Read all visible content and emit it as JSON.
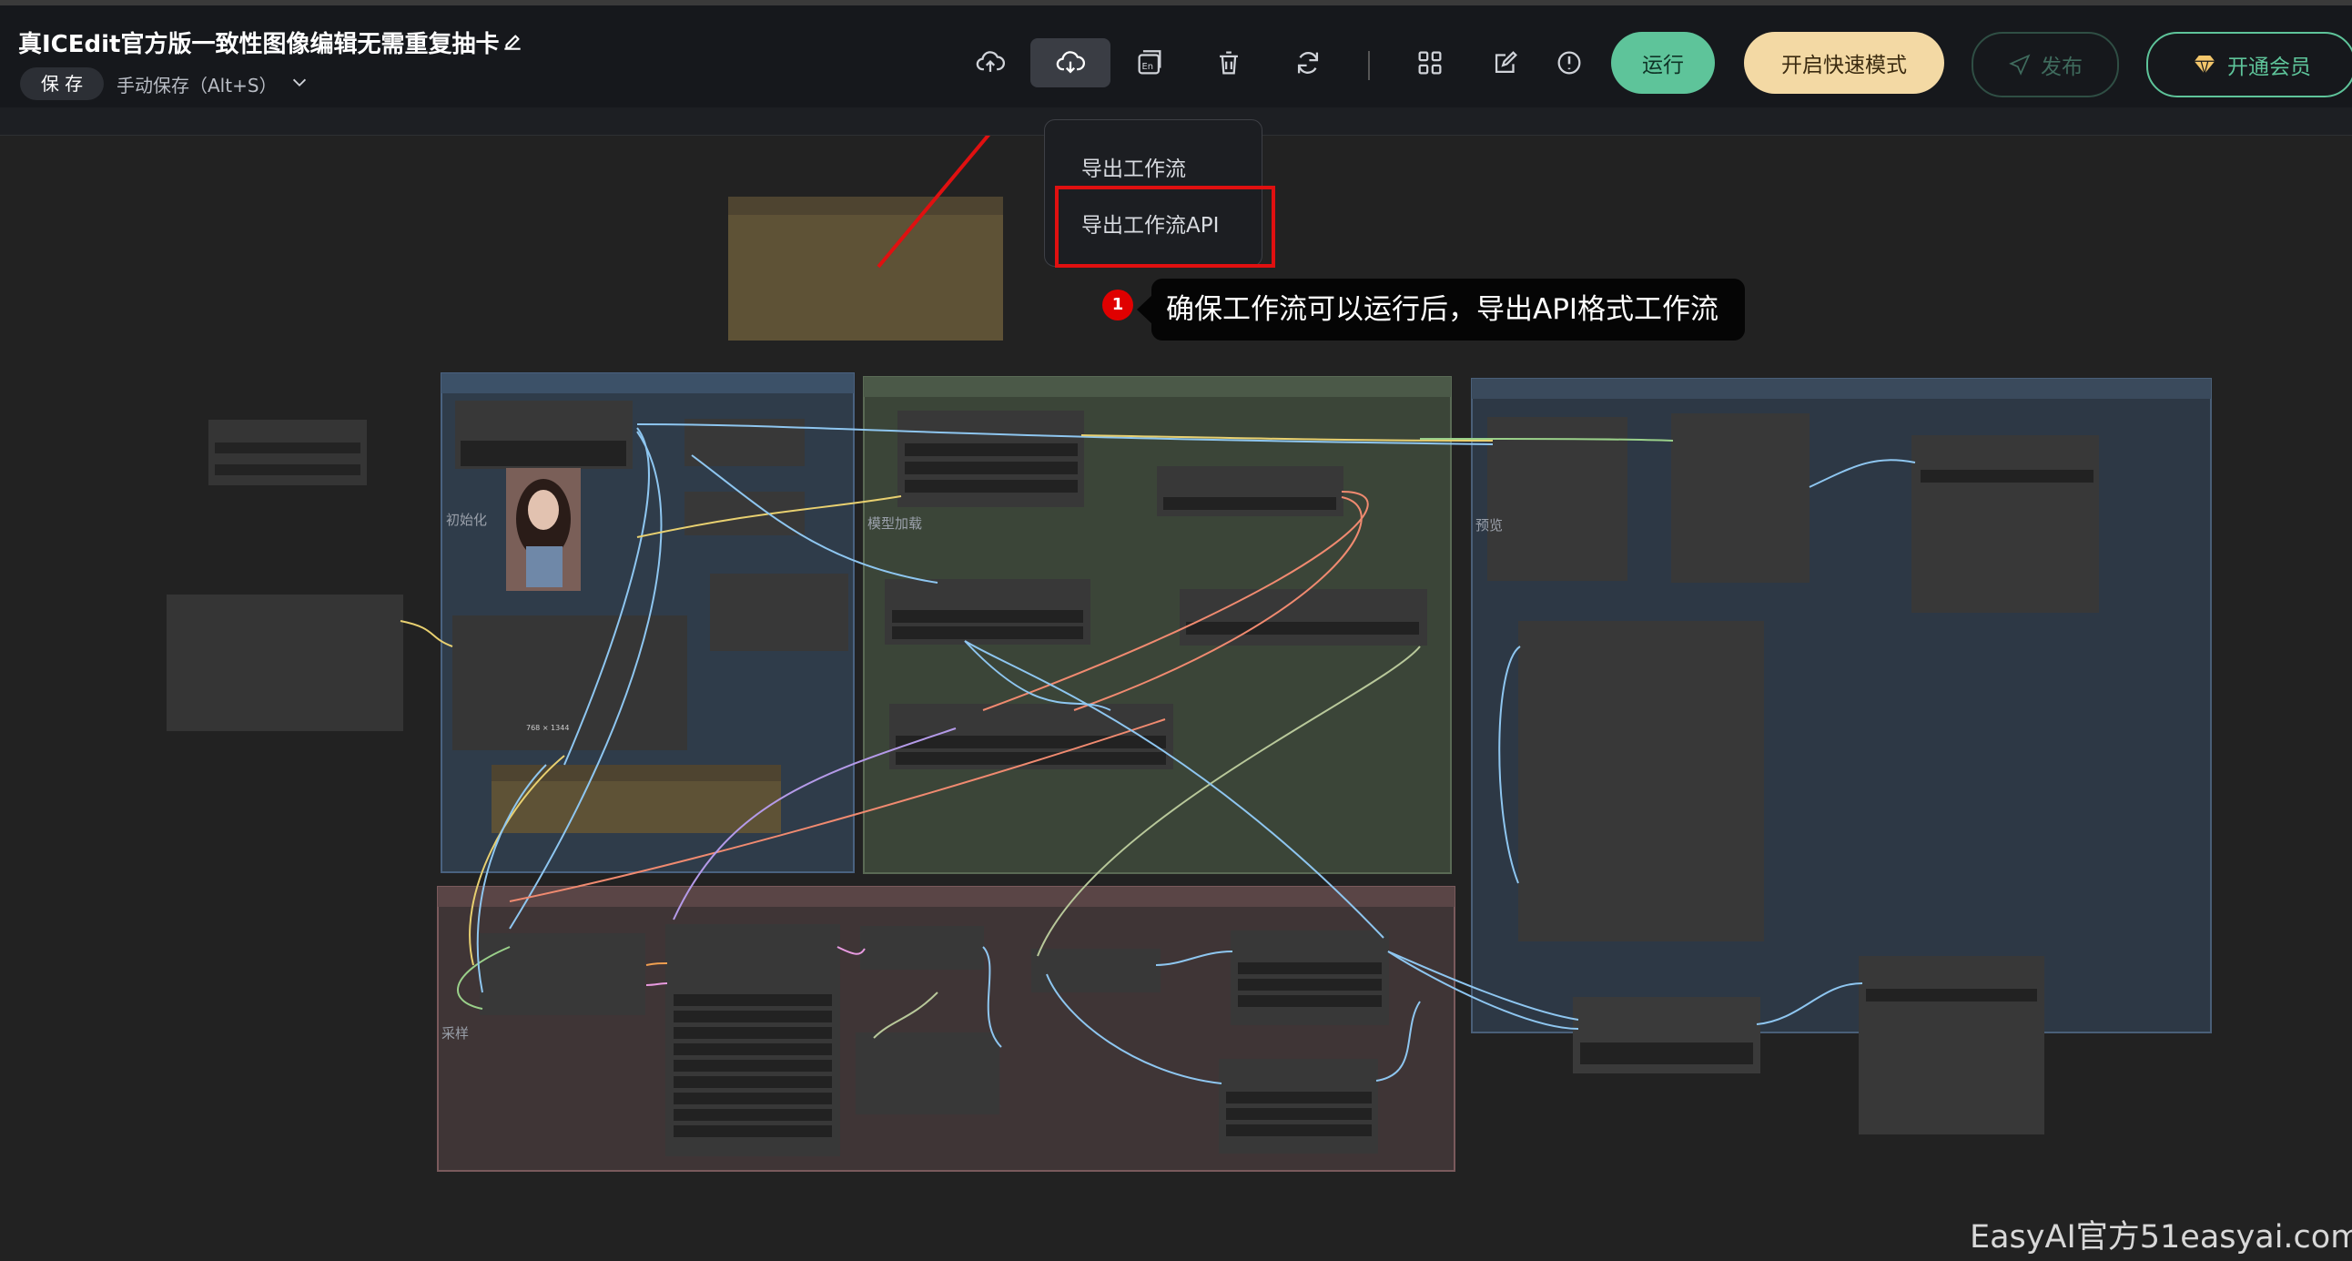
{
  "header": {
    "title": "真ICEdit官方版一致性图像编辑无需重复抽卡",
    "save_label": "保 存",
    "autosave_label": "手动保存（Alt+S）",
    "icons": [
      "upload-icon",
      "download-icon",
      "language-en-icon",
      "trash-icon",
      "refresh-icon",
      "grid-icon",
      "edit-note-icon",
      "info-icon"
    ],
    "run_label": "运行",
    "fast_mode_label": "开启快速模式",
    "publish_label": "发布",
    "member_label": "开通会员",
    "colors": {
      "run": "#5ec49a",
      "fast": "#f3d9a4",
      "member": "#5ec49a"
    }
  },
  "dropdown": {
    "items": [
      "导出工作流",
      "导出工作流API"
    ],
    "highlighted": "导出工作流API"
  },
  "annotation": {
    "step": "1",
    "text": "确保工作流可以运行后，导出API格式工作流",
    "color": "#e00000"
  },
  "canvas": {
    "groups": {
      "init": "初始化",
      "model": "模型加载",
      "preview": "预览",
      "sampling": "采样"
    },
    "image_caption": "768 × 1344"
  },
  "watermark": "EasyAI官方51easyai.com"
}
